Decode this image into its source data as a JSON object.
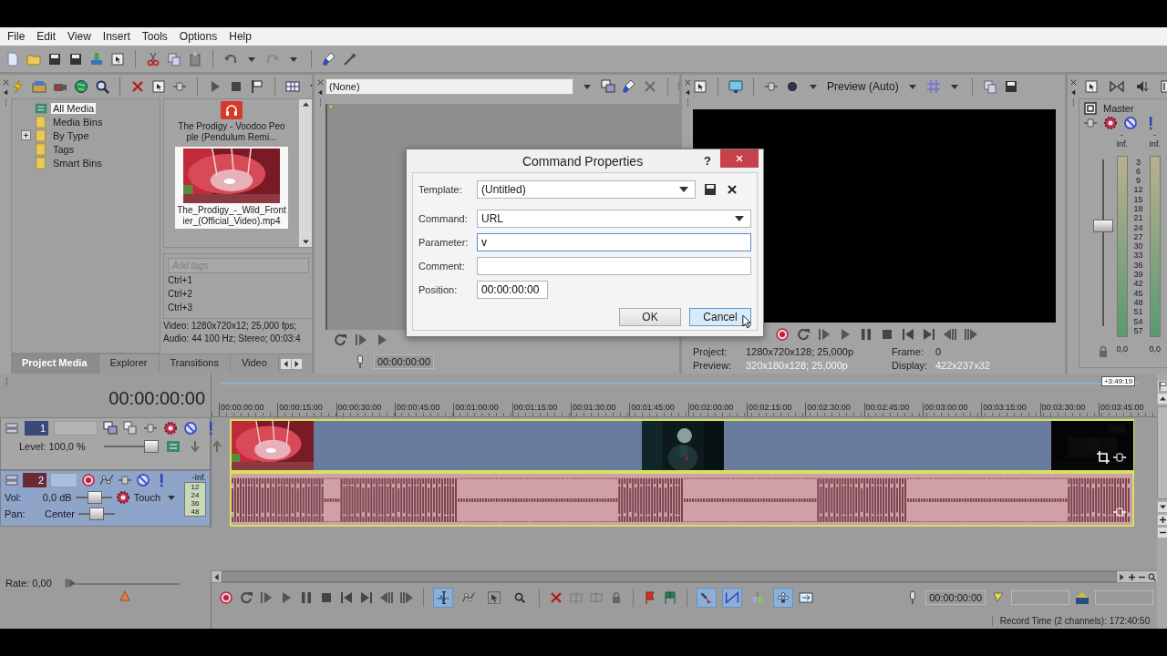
{
  "menu": [
    "File",
    "Edit",
    "View",
    "Insert",
    "Tools",
    "Options",
    "Help"
  ],
  "explorer": {
    "tree": [
      {
        "label": "All Media",
        "selected": true
      },
      {
        "label": "Media Bins",
        "selected": false
      },
      {
        "label": "By Type",
        "selected": false,
        "expanded": false
      },
      {
        "label": "Tags",
        "selected": false
      },
      {
        "label": "Smart Bins",
        "selected": false
      }
    ],
    "media": [
      {
        "kind": "audio",
        "title": "The Prodigy - Voodoo People (Pendulum Remi...",
        "selected": false
      },
      {
        "kind": "video",
        "title": "The_Prodigy_-_Wild_Frontier_(Official_Video).mp4",
        "selected": true
      }
    ],
    "tags_placeholder": "Add tags",
    "shortcuts": [
      "Ctrl+1",
      "Ctrl+2",
      "Ctrl+3"
    ],
    "info": [
      "Video: 1280x720x12; 25,000 fps;",
      "Audio: 44 100 Hz; Stereo; 00:03:4"
    ],
    "tabs": [
      {
        "label": "Project Media",
        "selected": true
      },
      {
        "label": "Explorer",
        "selected": false
      },
      {
        "label": "Transitions",
        "selected": false
      },
      {
        "label": "Video",
        "selected": false
      }
    ]
  },
  "trimmer": {
    "selector": "(None)",
    "timecode": "00:00:00:00"
  },
  "preview": {
    "quality": "Preview (Auto)",
    "info": [
      {
        "label": "Project:",
        "value": "1280x720x128; 25,000p"
      },
      {
        "label": "Frame:",
        "value": "0"
      },
      {
        "label": "Preview:",
        "value": "320x180x128; 25,000p"
      },
      {
        "label": "Display:",
        "value": "422x237x32"
      }
    ]
  },
  "master": {
    "title": "Master",
    "peaks": [
      "-Inf.",
      "-Inf."
    ],
    "scale": [
      "3",
      "6",
      "9",
      "12",
      "15",
      "18",
      "21",
      "24",
      "27",
      "30",
      "33",
      "36",
      "39",
      "42",
      "45",
      "48",
      "51",
      "54",
      "57"
    ],
    "readings": [
      "0,0",
      "0,0"
    ],
    "level": 0.6
  },
  "dialog": {
    "title": "Command Properties",
    "help": "?",
    "fields": [
      {
        "kind": "template",
        "label": "Template:",
        "value": "(Untitled)",
        "focused": false
      },
      {
        "kind": "dropdown",
        "label": "Command:",
        "value": "URL",
        "focused": false
      },
      {
        "kind": "text",
        "label": "Parameter:",
        "value": "v",
        "focused": true
      },
      {
        "kind": "text",
        "label": "Comment:",
        "focused": false
      },
      {
        "kind": "short",
        "label": "Position:",
        "value": "00:00:00:00",
        "focused": false
      }
    ],
    "buttons": [
      {
        "label": "OK",
        "hovered": false
      },
      {
        "label": "Cancel",
        "hovered": true
      }
    ]
  },
  "timeline": {
    "time": "00:00:00:00",
    "end_marker": "+3:49:19",
    "ruler": [
      "00:00:00:00",
      "00:00:15:00",
      "00:00:30:00",
      "00:00:45:00",
      "00:01:00:00",
      "00:01:15:00",
      "00:01:30:00",
      "00:01:45:00",
      "00:02:00:00",
      "00:02:15:00",
      "00:02:30:00",
      "00:02:45:00",
      "00:03:00:00",
      "00:03:15:00",
      "00:03:30:00",
      "00:03:45:00"
    ],
    "tracks": [
      {
        "kind": "video",
        "number": "1",
        "selected": false,
        "level_text": "Level: 100,0 %",
        "level": 1.0
      },
      {
        "kind": "audio",
        "number": "2",
        "selected": true,
        "vol": {
          "label": "Vol:",
          "value": "0,0 dB",
          "level": 0.55
        },
        "mode": "Touch",
        "pan": {
          "label": "Pan:",
          "value": "Center",
          "level": 0.5
        },
        "peak": "-Inf.",
        "meter_scale": [
          "12",
          "24",
          "36",
          "48"
        ]
      }
    ],
    "rate": {
      "text": "Rate: 0,00",
      "level": 0.5
    },
    "edit_tools": [
      {
        "selected": true
      },
      {
        "selected": false
      },
      {
        "selected": false
      },
      {
        "selected": false
      }
    ],
    "snap_tools": [
      {
        "on": true
      },
      {
        "on": true
      },
      {
        "on": false
      },
      {
        "on": true
      }
    ],
    "cursor_time": "00:00:00:00",
    "status": "Record Time (2 channels): 172:40:50"
  }
}
